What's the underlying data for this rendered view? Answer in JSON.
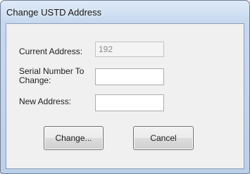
{
  "window": {
    "title": "Change USTD Address"
  },
  "form": {
    "current_address_label": "Current Address:",
    "current_address_value": "192",
    "serial_number_label_line1": "Serial Number To",
    "serial_number_label_line2": "Change:",
    "serial_number_value": "",
    "new_address_label": "New Address:",
    "new_address_value": ""
  },
  "buttons": {
    "change_label": "Change...",
    "cancel_label": "Cancel"
  }
}
